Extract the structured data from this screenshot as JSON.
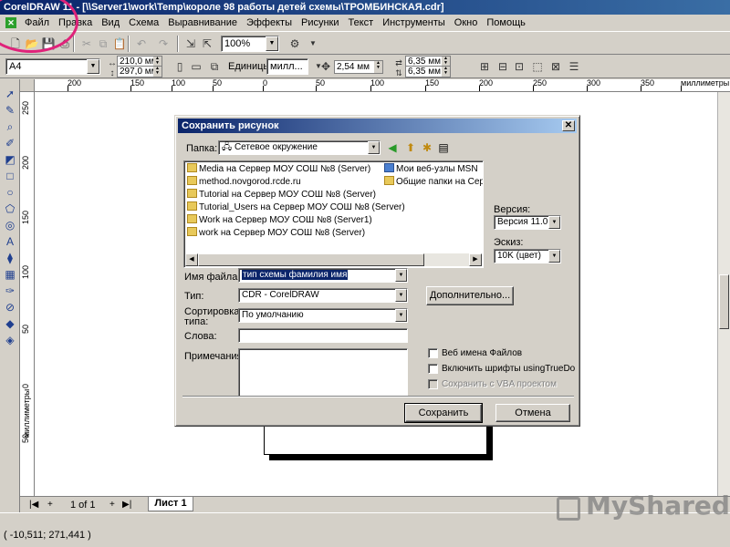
{
  "window": {
    "title": "CorelDRAW 11 - [\\\\Server1\\work\\Temp\\короле 98 работы детей схемы\\ТРОМБИНСКАЯ.cdr]"
  },
  "menu": [
    "Файл",
    "Правка",
    "Вид",
    "Схема",
    "Выравнивание",
    "Эффекты",
    "Рисунки",
    "Текст",
    "Инструменты",
    "Окно",
    "Помощь"
  ],
  "toolbar": {
    "zoom": "100%"
  },
  "property_bar": {
    "paper": "A4",
    "width": "210,0 мм",
    "height": "297,0 мм",
    "units_label": "Единицы:",
    "units_value": "милл...",
    "nudge": "2,54 мм",
    "dup_x": "6,35 мм",
    "dup_y": "6,35 мм"
  },
  "ruler": {
    "h_ticks": [
      "200",
      "150",
      "100",
      "50",
      "0",
      "50",
      "100",
      "150",
      "200",
      "250",
      "300",
      "350"
    ],
    "h_units": "миллиметры",
    "v_ticks": [
      "250",
      "200",
      "150",
      "100",
      "50",
      "0",
      "50"
    ],
    "v_units": "миллиметры"
  },
  "page_nav": {
    "count": "1 of 1",
    "sheet": "Лист 1"
  },
  "status": {
    "coords": "( -10,511; 271,441 )"
  },
  "watermark": "MyShared",
  "dialog": {
    "title": "Сохранить рисунок",
    "folder_label": "Папка:",
    "folder_value": "Сетевое окружение",
    "files_col1": [
      "Media на Сервер МОУ СОШ №8 (Server)",
      "method.novgorod.rcde.ru",
      "Tutorial на Сервер МОУ СОШ №8 (Server)",
      "Tutorial_Users на Сервер МОУ СОШ №8 (Server)",
      "Work на Сервер МОУ СОШ №8 (Server1)",
      "work на Сервер МОУ СОШ №8 (Server)"
    ],
    "files_col2": [
      "Мои веб-узлы MSN",
      "Общие папки на Серве"
    ],
    "filename_label": "Имя файла:",
    "filename_value": "тип схемы фамилия имя",
    "type_label": "Тип:",
    "type_value": "CDR - CorelDRAW",
    "sort_label": "Сортировка типа:",
    "sort_value": "По умолчанию",
    "keywords_label": "Слова:",
    "notes_label": "Примечания:",
    "version_label": "Версия:",
    "version_value": "Версия 11.0",
    "thumb_label": "Эскиз:",
    "thumb_value": "10K (цвет)",
    "advanced_button": "Дополнительно...",
    "chk_web_names": "Веб имена Файлов",
    "chk_embed_fonts": "Включить шрифты usingTrueDo",
    "chk_vba": "Сохранить с VBA проектом",
    "save_button": "Сохранить",
    "cancel_button": "Отмена"
  }
}
